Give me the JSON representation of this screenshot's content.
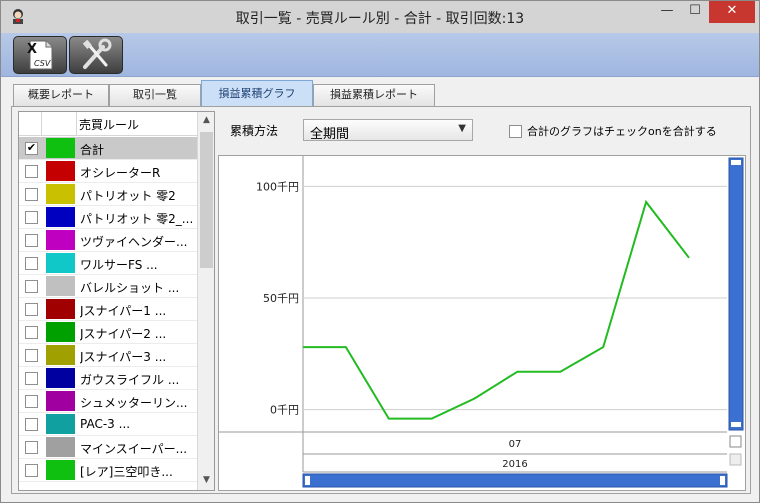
{
  "window": {
    "title": "取引一覧 - 売買ルール別 - 合計 - 取引回数:13"
  },
  "titlebar_buttons": {
    "minimize": "—",
    "maximize": "☐",
    "close": "✕"
  },
  "toolbar": {
    "csv_button": "CSV",
    "settings_button": "settings"
  },
  "tabs": [
    {
      "label": "概要レポート",
      "active": false
    },
    {
      "label": "取引一覧",
      "active": false
    },
    {
      "label": "損益累積グラフ",
      "active": true
    },
    {
      "label": "損益累積レポート",
      "active": false
    }
  ],
  "list": {
    "header": "売買ルール",
    "items": [
      {
        "label": "合計",
        "color": "#10c010",
        "checked": true,
        "selected": true
      },
      {
        "label": "オシレーターR",
        "color": "#c40000",
        "checked": false
      },
      {
        "label": "パトリオット 零2",
        "color": "#c8c000",
        "checked": false
      },
      {
        "label": "パトリオット 零2_...",
        "color": "#0000c0",
        "checked": false
      },
      {
        "label": "ツヴァイヘンダー...",
        "color": "#c000c0",
        "checked": false
      },
      {
        "label": "ワルサーFS      ...",
        "color": "#10c8c8",
        "checked": false
      },
      {
        "label": "バレルショット    ...",
        "color": "#c0c0c0",
        "checked": false
      },
      {
        "label": "Jスナイパー1     ...",
        "color": "#a00000",
        "checked": false
      },
      {
        "label": "Jスナイパー2     ...",
        "color": "#00a000",
        "checked": false
      },
      {
        "label": "Jスナイパー3     ...",
        "color": "#a0a000",
        "checked": false
      },
      {
        "label": "ガウスライフル    ...",
        "color": "#0000a0",
        "checked": false
      },
      {
        "label": "シュメッターリン...",
        "color": "#a000a0",
        "checked": false
      },
      {
        "label": "PAC-3          ...",
        "color": "#10a0a0",
        "checked": false
      },
      {
        "label": "マインスイーパー...",
        "color": "#a0a0a0",
        "checked": false
      },
      {
        "label": "[レア]三空叩き...",
        "color": "#10c010",
        "checked": false
      }
    ]
  },
  "controls": {
    "method_label": "累積方法",
    "method_value": "全期間",
    "sum_label": "合計のグラフはチェックonを合計する"
  },
  "chart_data": {
    "type": "line",
    "y_tick_labels": [
      "100千円",
      "50千円",
      "0千円"
    ],
    "y_ticks": [
      100,
      50,
      0
    ],
    "ylim": [
      -10,
      110
    ],
    "x_axis_rows": [
      "07",
      "2016"
    ],
    "series": [
      {
        "color": "#22bb22",
        "x": [
          0,
          1,
          2,
          3,
          4,
          5,
          6,
          7,
          8,
          9
        ],
        "y": [
          28,
          28,
          -4,
          -4,
          5,
          17,
          17,
          28,
          93,
          68
        ]
      }
    ]
  }
}
